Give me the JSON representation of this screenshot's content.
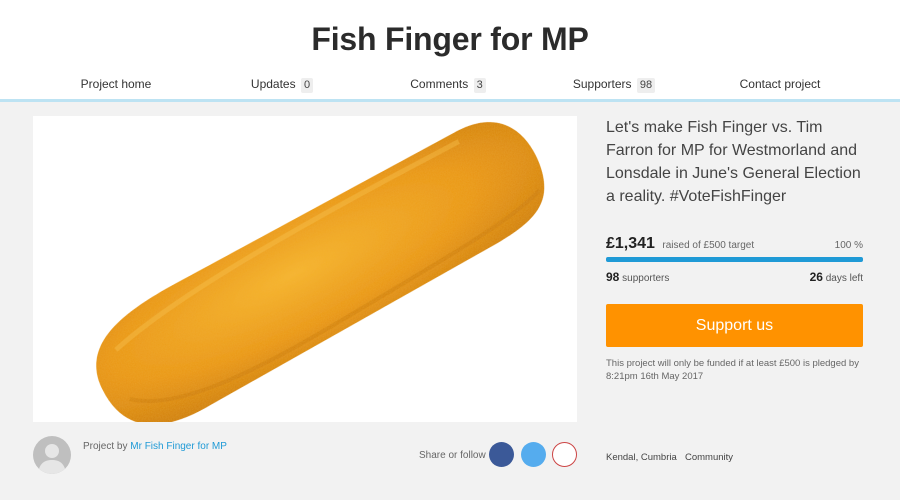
{
  "header": {
    "title": "Fish Finger for MP"
  },
  "tabs": [
    {
      "label": "Project home",
      "count": null
    },
    {
      "label": "Updates",
      "count": "0"
    },
    {
      "label": "Comments",
      "count": "3"
    },
    {
      "label": "Supporters",
      "count": "98"
    },
    {
      "label": "Contact project",
      "count": null
    }
  ],
  "pitch": "Let's make Fish Finger vs. Tim Farron for MP for Westmorland and Lonsdale in June's General Election a reality. #VoteFishFinger",
  "funding": {
    "amount": "£1,341",
    "raised_text": "raised of £500 target",
    "percent_text": "100 %",
    "progress_fraction": 1.0,
    "supporters_count": "98",
    "supporters_label": "supporters",
    "days_count": "26",
    "days_label": "days left"
  },
  "cta": {
    "label": "Support us"
  },
  "note": "This project will only be funded if at least £500 is pledged by 8:21pm 16th May 2017",
  "owner": {
    "prefix": "Project by",
    "name": "Mr Fish Finger for MP"
  },
  "share": {
    "label": "Share or follow",
    "icons": [
      "facebook-icon",
      "twitter-icon",
      "email-icon"
    ]
  },
  "meta": {
    "location": "Kendal, Cumbria",
    "category": "Community"
  },
  "colors": {
    "accent": "#1f9ad6",
    "cta": "#ff9200"
  }
}
